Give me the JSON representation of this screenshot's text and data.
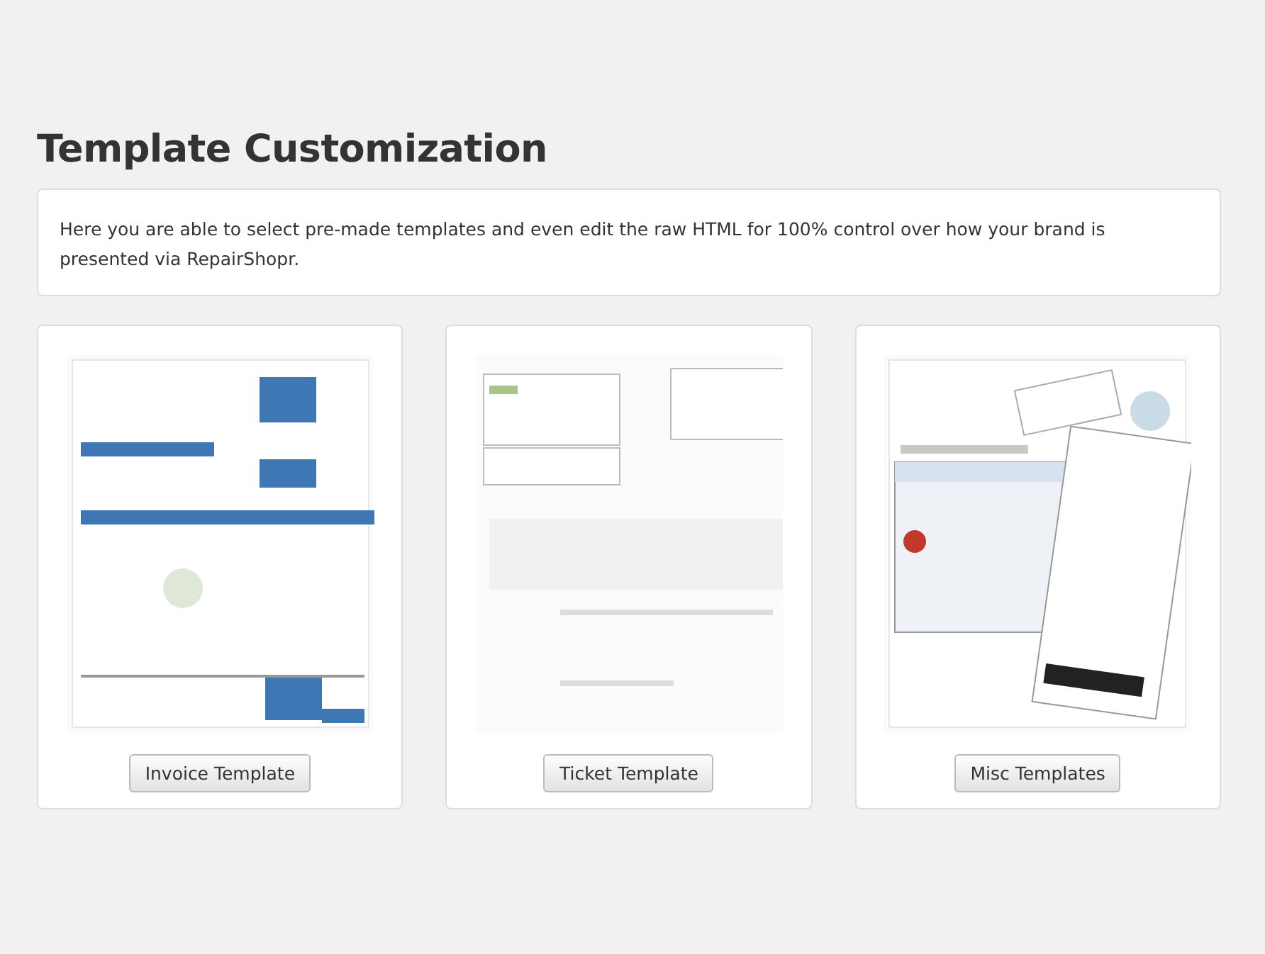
{
  "title": "Template Customization",
  "description": "Here you are able to select pre-made templates and even edit the raw HTML for 100% control over how your brand is presented via RepairShopr.",
  "cards": [
    {
      "button": "Invoice Template"
    },
    {
      "button": "Ticket Template"
    },
    {
      "button": "Misc Templates"
    }
  ]
}
